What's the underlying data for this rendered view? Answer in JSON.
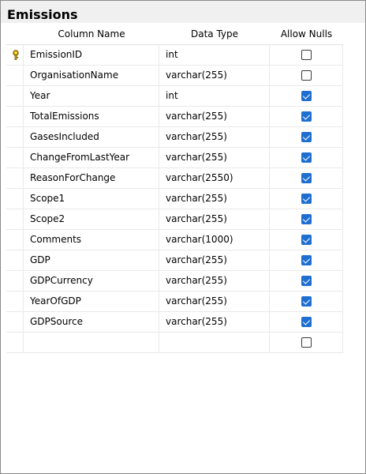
{
  "window": {
    "title": "Emissions"
  },
  "columns": {
    "name": "Column Name",
    "type": "Data Type",
    "nulls": "Allow Nulls"
  },
  "colors": {
    "checkbox_on": "#1f6fd1",
    "key": "#e2b400"
  },
  "rows": [
    {
      "name": "EmissionID",
      "type": "int",
      "allow_nulls": false,
      "primary_key": true
    },
    {
      "name": "OrganisationName",
      "type": "varchar(255)",
      "allow_nulls": false
    },
    {
      "name": "Year",
      "type": "int",
      "allow_nulls": true
    },
    {
      "name": "TotalEmissions",
      "type": "varchar(255)",
      "allow_nulls": true
    },
    {
      "name": "GasesIncluded",
      "type": "varchar(255)",
      "allow_nulls": true
    },
    {
      "name": "ChangeFromLastYear",
      "type": "varchar(255)",
      "allow_nulls": true
    },
    {
      "name": "ReasonForChange",
      "type": "varchar(2550)",
      "allow_nulls": true
    },
    {
      "name": "Scope1",
      "type": "varchar(255)",
      "allow_nulls": true
    },
    {
      "name": "Scope2",
      "type": "varchar(255)",
      "allow_nulls": true
    },
    {
      "name": "Comments",
      "type": "varchar(1000)",
      "allow_nulls": true
    },
    {
      "name": "GDP",
      "type": "varchar(255)",
      "allow_nulls": true
    },
    {
      "name": "GDPCurrency",
      "type": "varchar(255)",
      "allow_nulls": true
    },
    {
      "name": "YearOfGDP",
      "type": "varchar(255)",
      "allow_nulls": true
    },
    {
      "name": "GDPSource",
      "type": "varchar(255)",
      "allow_nulls": true
    },
    {
      "name": "",
      "type": "",
      "allow_nulls": false
    }
  ]
}
